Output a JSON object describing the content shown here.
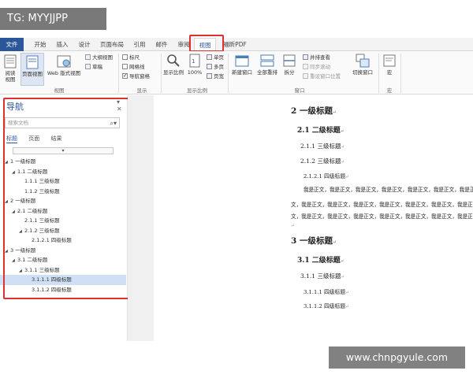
{
  "watermark_top": "TG: MYYJJPP",
  "watermark_bottom": "www.chnpgyule.com",
  "tabs": [
    "文件",
    "开始",
    "插入",
    "设计",
    "页面布局",
    "引用",
    "邮件",
    "审阅",
    "视图",
    "福昕PDF"
  ],
  "ribbon": {
    "views": {
      "read_mode": "阅读\n视图",
      "print_layout": "页面视图",
      "web_layout": "Web 版式视图",
      "outline": "大纲视图",
      "draft": "草稿"
    },
    "show": {
      "ruler": "标尺",
      "gridlines": "网格线",
      "nav_pane": "导航窗格"
    },
    "zoom": {
      "zoom": "显示比例",
      "100": "100%",
      "one_page": "单页",
      "multi_page": "多页",
      "page_width": "页宽"
    },
    "window": {
      "new_window": "新建窗口",
      "arrange_all": "全部重排",
      "split": "拆分",
      "side_by_side": "并排查看",
      "sync_scroll": "同步滚动",
      "reset_pos": "重设窗口位置",
      "switch": "切换窗口"
    },
    "macro": "宏",
    "group_labels": {
      "views": "视图",
      "show": "显示",
      "zoom": "显示比例",
      "window": "窗口",
      "macro": "宏"
    }
  },
  "nav": {
    "title": "导航",
    "search_placeholder": "搜索文档",
    "tabs": [
      "标题",
      "页面",
      "结果"
    ],
    "tree": [
      {
        "text": "1 一级标题"
      },
      {
        "text": "1.1 二级标题"
      },
      {
        "text": "1.1.1 三级标题"
      },
      {
        "text": "1.1.2 三级标题"
      },
      {
        "text": "2 一级标题"
      },
      {
        "text": "2.1 二级标题"
      },
      {
        "text": "2.1.1 三级标题"
      },
      {
        "text": "2.1.2 三级标题"
      },
      {
        "text": "2.1.2.1 四级标题"
      },
      {
        "text": "3 一级标题"
      },
      {
        "text": "3.1 二级标题"
      },
      {
        "text": "3.1.1 三级标题"
      },
      {
        "text": "3.1.1.1 四级标题"
      },
      {
        "text": "3.1.1.2 四级标题"
      }
    ]
  },
  "doc": {
    "h2_1": "2 一级标题",
    "h3_1": "2.1 二级标题",
    "h4_1": "2.1.1 三级标题",
    "h4_2": "2.1.2 三级标题",
    "h5_1": "2.1.2.1 四级标题",
    "body_1": "我是正文，我是正文，我是正文，我是正文，我是正文，我是正文，我是正",
    "body_2": "文，我是正文，我是正文，我是正文，我是正文，我是正文，我是正文，我是正文，",
    "body_3": "文，我是正文，我是正文，我是正文，我是正文，我是正文，我是正文，我是正文。",
    "h2_2": "3 一级标题",
    "h3_2": "3.1 二级标题",
    "h4_3": "3.1.1 三级标题",
    "h5_2": "3.1.1.1 四级标题",
    "h5_3": "3.1.1.2 四级标题"
  }
}
